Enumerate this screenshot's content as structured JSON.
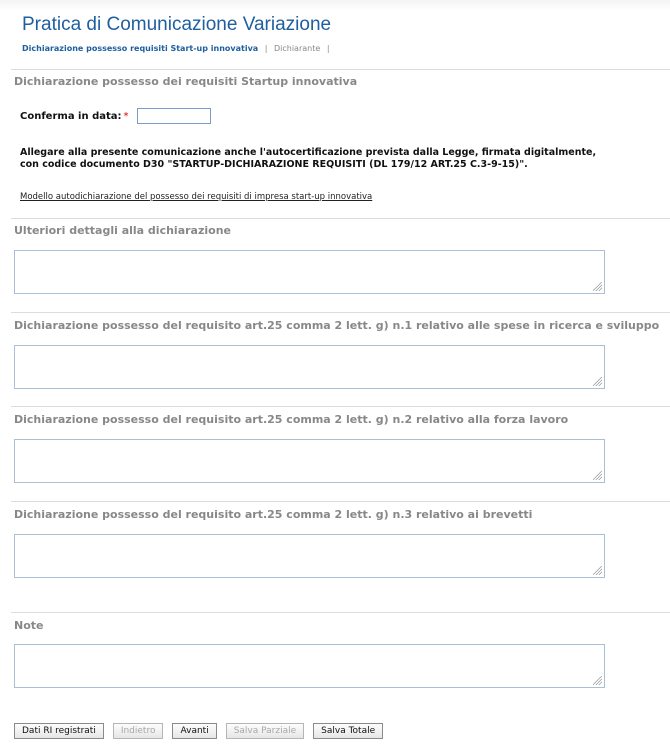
{
  "header": {
    "title": "Pratica di Comunicazione Variazione",
    "breadcrumb": {
      "active": "Dichiarazione possesso requisiti Start-up innovativa",
      "separator": "|",
      "next": "Dichiarante"
    }
  },
  "section_main": {
    "title": "Dichiarazione possesso dei requisiti Startup innovativa",
    "confirm_label": "Conferma in data:",
    "required_marker": "*",
    "date_value": "",
    "instructions_line1": "Allegare alla presente comunicazione anche l'autocertificazione prevista dalla Legge, firmata digitalmente,",
    "instructions_line2": "con codice documento D30 \"STARTUP-DICHIARAZIONE REQUISITI (DL 179/12 ART.25 C.3-9-15)\".",
    "model_link": "Modello autodichiarazione del possesso dei requisiti di impresa start-up innovativa"
  },
  "sections": [
    {
      "title": "Ulteriori dettagli alla dichiarazione",
      "value": ""
    },
    {
      "title": "Dichiarazione possesso del requisito art.25 comma 2 lett. g) n.1 relativo alle spese in ricerca e sviluppo",
      "value": ""
    },
    {
      "title": "Dichiarazione possesso del requisito art.25 comma 2 lett. g) n.2 relativo alla forza lavoro",
      "value": ""
    },
    {
      "title": "Dichiarazione possesso del requisito art.25 comma 2 lett. g) n.3 relativo ai brevetti",
      "value": ""
    },
    {
      "title": "Note",
      "value": ""
    }
  ],
  "buttons": {
    "dati_ri": "Dati RI registrati",
    "indietro": "Indietro",
    "avanti": "Avanti",
    "salva_parziale": "Salva Parziale",
    "salva_totale": "Salva Totale"
  },
  "colors": {
    "title_blue": "#1f5fa0",
    "required_red": "#d10000",
    "section_grey": "#888888"
  }
}
